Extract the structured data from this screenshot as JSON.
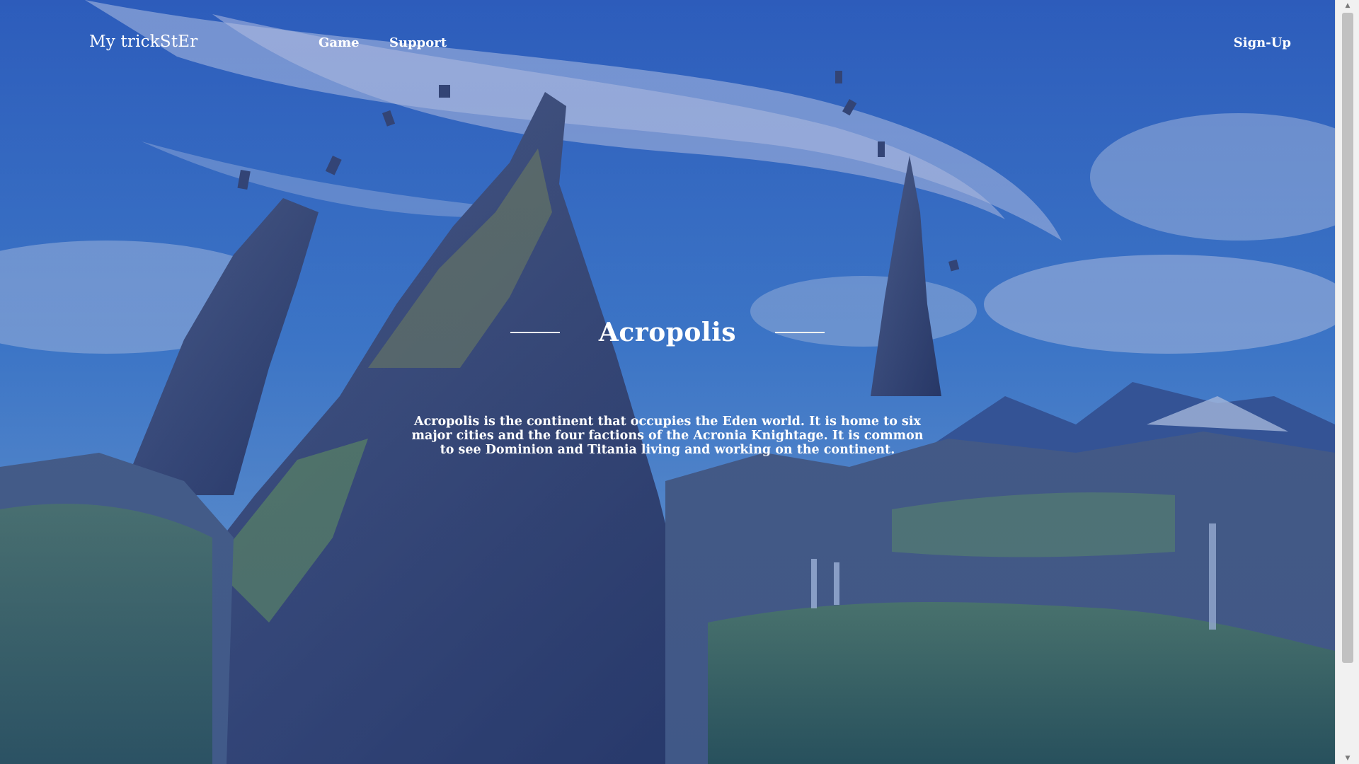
{
  "nav": {
    "brand": "My trickStEr",
    "links": [
      "Game",
      "Support"
    ],
    "signup": "Sign-Up"
  },
  "hero": {
    "title": "Acropolis",
    "description": "Acropolis is the continent that occupies the Eden world. It is home to six major cities and the four factions of the Acronia Knightage. It is common to see Dominion and Titania living and working on the continent."
  },
  "colors": {
    "sky_overlay": "#2c5fb0",
    "text": "#ffffff",
    "scrollbar_track": "#f1f1f1",
    "scrollbar_thumb": "#c1c1c1"
  },
  "icons": {
    "scroll_up": "scroll-up-arrow-icon",
    "scroll_down": "scroll-down-arrow-icon"
  },
  "scrollbar": {
    "visible_fraction": 0.88
  }
}
